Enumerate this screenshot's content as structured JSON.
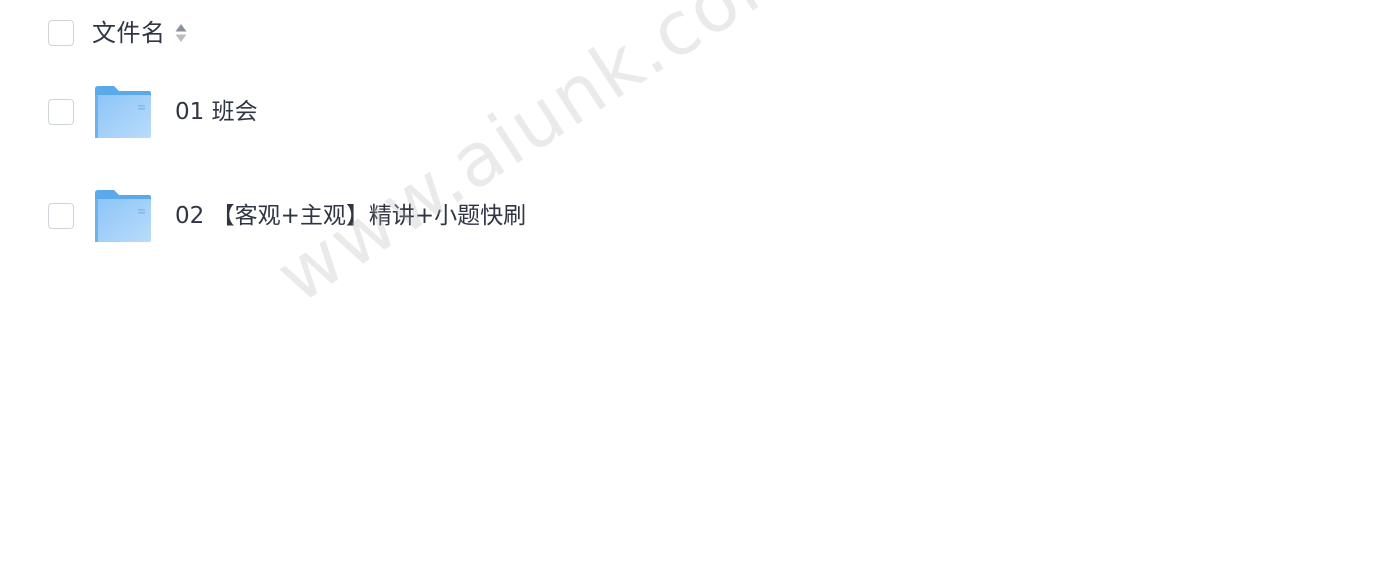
{
  "header": {
    "column_label": "文件名",
    "sort_icon": "sort-updown-icon"
  },
  "files": [
    {
      "name": "01 班会",
      "icon": "folder-icon",
      "type": "folder"
    },
    {
      "name": "02 【客观+主观】精讲+小题快刷",
      "icon": "folder-icon",
      "type": "folder"
    }
  ],
  "watermark": "www.aiunk.com",
  "colors": {
    "folder_light": "#a9d4fa",
    "folder_dark": "#5aa9ea",
    "checkbox_border": "#cfd4da",
    "text": "#2f3542"
  }
}
